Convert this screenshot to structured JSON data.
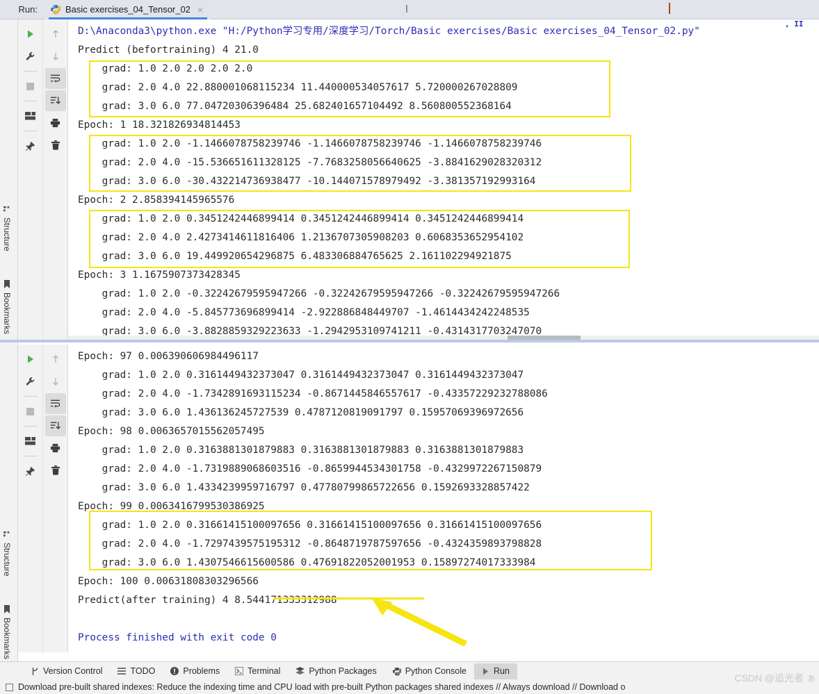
{
  "window": {
    "run_label": "Run:",
    "tab_title": "Basic exercises_04_Tensor_02",
    "tab_close": "×",
    "python_icon": "python-icon"
  },
  "rails": {
    "top": [
      {
        "label": "Structure",
        "icon": "structure-icon"
      },
      {
        "label": "Bookmarks",
        "icon": "bookmark-icon"
      }
    ],
    "bottom": [
      {
        "label": "Structure",
        "icon": "structure-icon"
      },
      {
        "label": "Bookmarks",
        "icon": "bookmark-icon"
      }
    ]
  },
  "toolbar_primary": [
    {
      "name": "rerun-button",
      "icon": "play-icon"
    },
    {
      "name": "modify-run-configuration-button",
      "icon": "wrench-icon"
    },
    {
      "name": "stop-button",
      "icon": "stop-icon"
    },
    {
      "name": "restore-layout-button",
      "icon": "layout-icon"
    },
    {
      "name": "pin-tab-button",
      "icon": "pin-icon"
    }
  ],
  "toolbar_secondary": [
    {
      "name": "previous-occurrence-button",
      "icon": "arrow-up-icon"
    },
    {
      "name": "next-occurrence-button",
      "icon": "arrow-down-icon"
    },
    {
      "name": "soft-wrap-button",
      "icon": "soft-wrap-icon",
      "active": true
    },
    {
      "name": "scroll-to-end-button",
      "icon": "scroll-to-end-icon",
      "active": true
    },
    {
      "name": "print-button",
      "icon": "printer-icon"
    },
    {
      "name": "clear-all-button",
      "icon": "trash-icon"
    }
  ],
  "console_top": {
    "lines": [
      {
        "text": "D:\\Anaconda3\\python.exe \"H:/Python学习专用/深度学习/Torch/Basic exercises/Basic exercises_04_Tensor_02.py\"",
        "style": "blue"
      },
      {
        "text": "Predict (befortraining) 4 21.0",
        "style": "plain"
      },
      {
        "text": "    grad: 1.0 2.0 2.0 2.0 2.0",
        "style": "plain"
      },
      {
        "text": "    grad: 2.0 4.0 22.880001068115234 11.440000534057617 5.720000267028809",
        "style": "plain"
      },
      {
        "text": "    grad: 3.0 6.0 77.04720306396484 25.682401657104492 8.560800552368164",
        "style": "plain"
      },
      {
        "text": "Epoch: 1 18.321826934814453",
        "style": "plain"
      },
      {
        "text": "    grad: 1.0 2.0 -1.1466078758239746 -1.1466078758239746 -1.1466078758239746",
        "style": "plain"
      },
      {
        "text": "    grad: 2.0 4.0 -15.536651611328125 -7.7683258056640625 -3.8841629028320312",
        "style": "plain"
      },
      {
        "text": "    grad: 3.0 6.0 -30.432214736938477 -10.144071578979492 -3.381357192993164",
        "style": "plain"
      },
      {
        "text": "Epoch: 2 2.858394145965576",
        "style": "plain"
      },
      {
        "text": "    grad: 1.0 2.0 0.3451242446899414 0.3451242446899414 0.3451242446899414",
        "style": "plain"
      },
      {
        "text": "    grad: 2.0 4.0 2.4273414611816406 1.2136707305908203 0.6068353652954102",
        "style": "plain"
      },
      {
        "text": "    grad: 3.0 6.0 19.449920654296875 6.483306884765625 2.161102294921875",
        "style": "plain"
      },
      {
        "text": "Epoch: 3 1.1675907373428345",
        "style": "plain"
      },
      {
        "text": "    grad: 1.0 2.0 -0.32242679595947266 -0.32242679595947266 -0.32242679595947266",
        "style": "plain"
      },
      {
        "text": "    grad: 2.0 4.0 -5.845773696899414 -2.922886848449707 -1.4614434242248535",
        "style": "plain"
      },
      {
        "text": "    grad: 3.0 6.0 -3.8828859329223633 -1.2942953109741211 -0.4314317703247070",
        "style": "plain"
      }
    ]
  },
  "console_bottom": {
    "lines": [
      {
        "text": "Epoch: 97 0.006390606984496117",
        "style": "plain"
      },
      {
        "text": "    grad: 1.0 2.0 0.3161449432373047 0.3161449432373047 0.3161449432373047",
        "style": "plain"
      },
      {
        "text": "    grad: 2.0 4.0 -1.7342891693115234 -0.8671445846557617 -0.43357229232788086",
        "style": "plain"
      },
      {
        "text": "    grad: 3.0 6.0 1.436136245727539 0.4787120819091797 0.15957069396972656",
        "style": "plain"
      },
      {
        "text": "Epoch: 98 0.0063657015562057495",
        "style": "plain"
      },
      {
        "text": "    grad: 1.0 2.0 0.3163881301879883 0.3163881301879883 0.3163881301879883",
        "style": "plain"
      },
      {
        "text": "    grad: 2.0 4.0 -1.7319889068603516 -0.8659944534301758 -0.4329972267150879",
        "style": "plain"
      },
      {
        "text": "    grad: 3.0 6.0 1.4334239959716797 0.47780799865722656 0.1592693328857422",
        "style": "plain"
      },
      {
        "text": "Epoch: 99 0.0063416799530386925",
        "style": "plain"
      },
      {
        "text": "    grad: 1.0 2.0 0.31661415100097656 0.31661415100097656 0.31661415100097656",
        "style": "plain"
      },
      {
        "text": "    grad: 2.0 4.0 -1.7297439575195312 -0.8648719787597656 -0.4324359893798828",
        "style": "plain"
      },
      {
        "text": "    grad: 3.0 6.0 1.4307546615600586 0.47691822052001953 0.15897274017333984",
        "style": "plain"
      },
      {
        "text": "Epoch: 100 0.00631808303296566",
        "style": "plain"
      },
      {
        "text": "Predict(after training) 4 8.544171333312988",
        "style": "plain"
      },
      {
        "text": "",
        "style": "plain"
      },
      {
        "text": "Process finished with exit code 0",
        "style": "blue"
      }
    ]
  },
  "annotations": {
    "highlight_color": "#f5e513",
    "boxes": [
      {
        "name": "highlight-epoch-1"
      },
      {
        "name": "highlight-epoch-2"
      },
      {
        "name": "highlight-epoch-3"
      },
      {
        "name": "highlight-epoch-100"
      }
    ],
    "underline": {
      "name": "underline-final-prediction"
    },
    "arrow": {
      "name": "arrow-pointing-to-final-prediction"
    }
  },
  "bottom_toolbar": [
    {
      "label": "Version Control",
      "icon": "branch-icon",
      "selected": false
    },
    {
      "label": "TODO",
      "icon": "list-icon",
      "selected": false
    },
    {
      "label": "Problems",
      "icon": "error-icon",
      "selected": false
    },
    {
      "label": "Terminal",
      "icon": "terminal-icon",
      "selected": false
    },
    {
      "label": "Python Packages",
      "icon": "packages-icon",
      "selected": false
    },
    {
      "label": "Python Console",
      "icon": "python-console-icon",
      "selected": false
    },
    {
      "label": "Run",
      "icon": "play-icon",
      "selected": true
    }
  ],
  "status_bar": {
    "text": "Download pre-built shared indexes: Reduce the indexing time and CPU load with pre-built Python packages shared indexes // Always download // Download o",
    "icon": "checkbox-icon"
  },
  "watermark": "CSDN @追光者 ぁ"
}
